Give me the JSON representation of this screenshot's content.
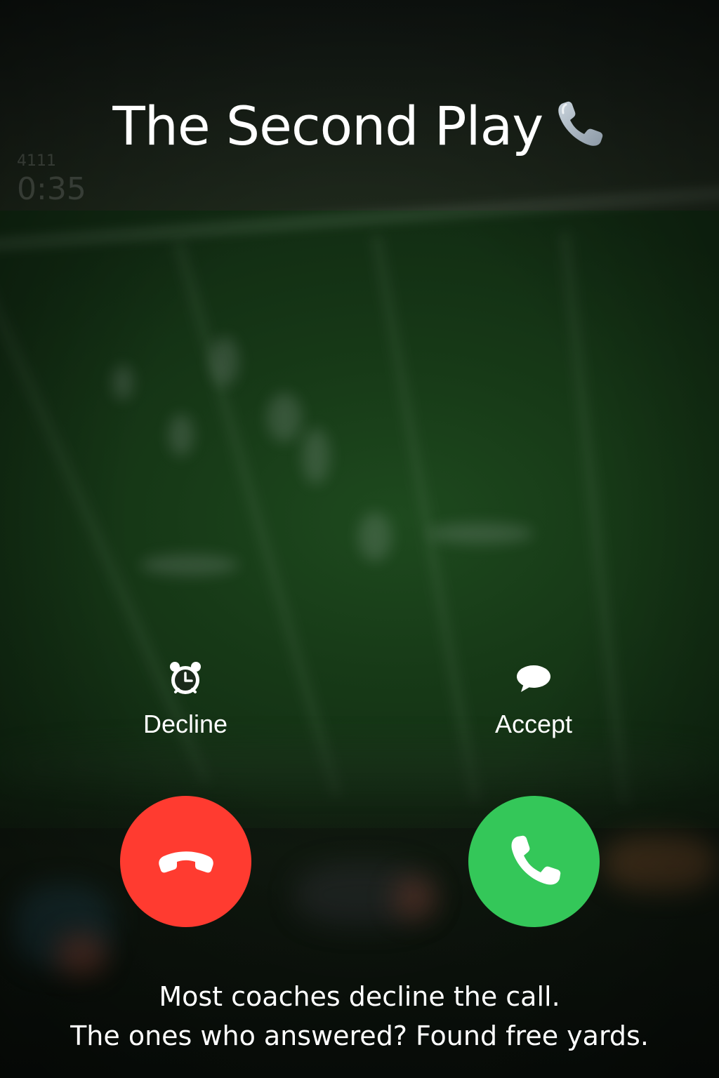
{
  "caller": {
    "name": "The Second Play",
    "icon": "telephone-receiver-icon"
  },
  "scoreboard": {
    "top_text": "4111",
    "clock": "0:35"
  },
  "options": {
    "left": {
      "icon": "alarm-clock-icon",
      "label": "Decline"
    },
    "right": {
      "icon": "message-bubble-icon",
      "label": "Accept"
    }
  },
  "buttons": {
    "decline": {
      "icon": "phone-hangup-icon",
      "color": "#ff3b30"
    },
    "accept": {
      "icon": "phone-answer-icon",
      "color": "#34c759"
    }
  },
  "caption": {
    "line1": "Most coaches decline the call.",
    "line2": "The ones who answered? Found free yards."
  }
}
